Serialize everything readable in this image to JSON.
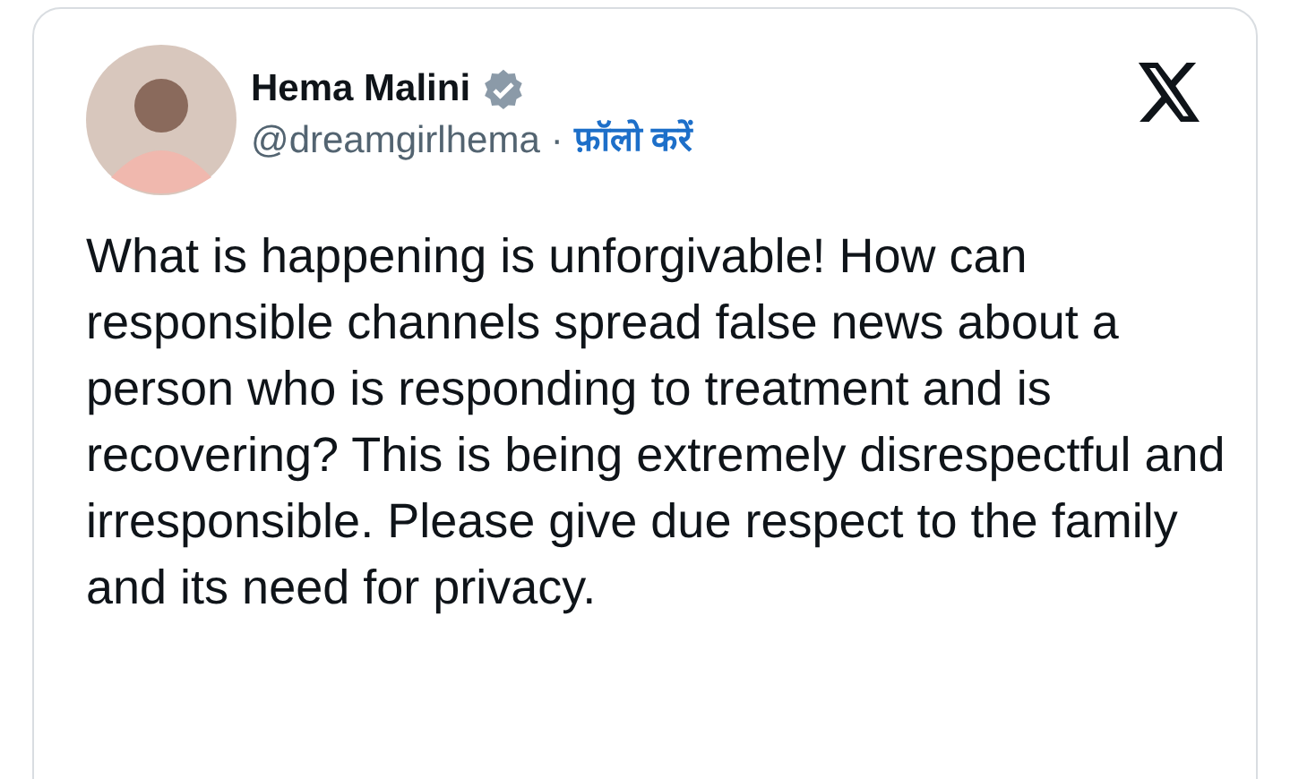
{
  "post": {
    "author": {
      "name": "Hema Malini",
      "verified": true,
      "handle": "@dreamgirlhema",
      "separator": "·",
      "follow": "फ़ॉलो करें"
    },
    "text": "What is happening is unforgivable! How can responsible channels spread false news about a person who is responding to treatment and is recovering? This is being extremely disrespectful and irresponsible. Please give due respect to the family and its need for privacy."
  }
}
